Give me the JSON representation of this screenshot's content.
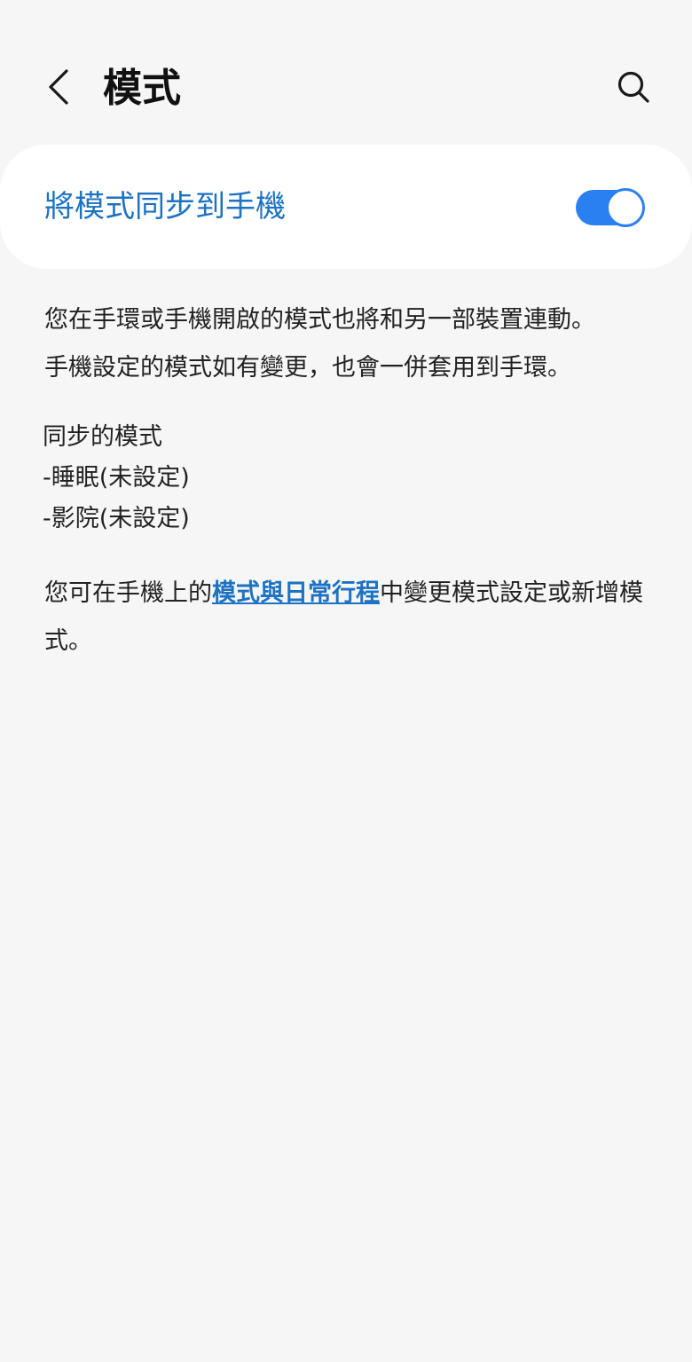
{
  "header": {
    "title": "模式",
    "back_icon": "chevron-left-icon",
    "search_icon": "search-icon"
  },
  "sync": {
    "label": "將模式同步到手機",
    "enabled": true,
    "accent_color": "#2a80f0",
    "label_color": "#1d72c2"
  },
  "description": {
    "line1": "您在手環或手機開啟的模式也將和另一部裝置連動。",
    "line2": "手機設定的模式如有變更，也會一併套用到手環。"
  },
  "modes": {
    "heading": "同步的模式",
    "items": [
      "-睡眠(未設定)",
      "-影院(未設定)"
    ]
  },
  "footer": {
    "prefix": "您可在手機上的",
    "link": "模式與日常行程",
    "suffix": "中變更模式設定或新增模式。"
  }
}
